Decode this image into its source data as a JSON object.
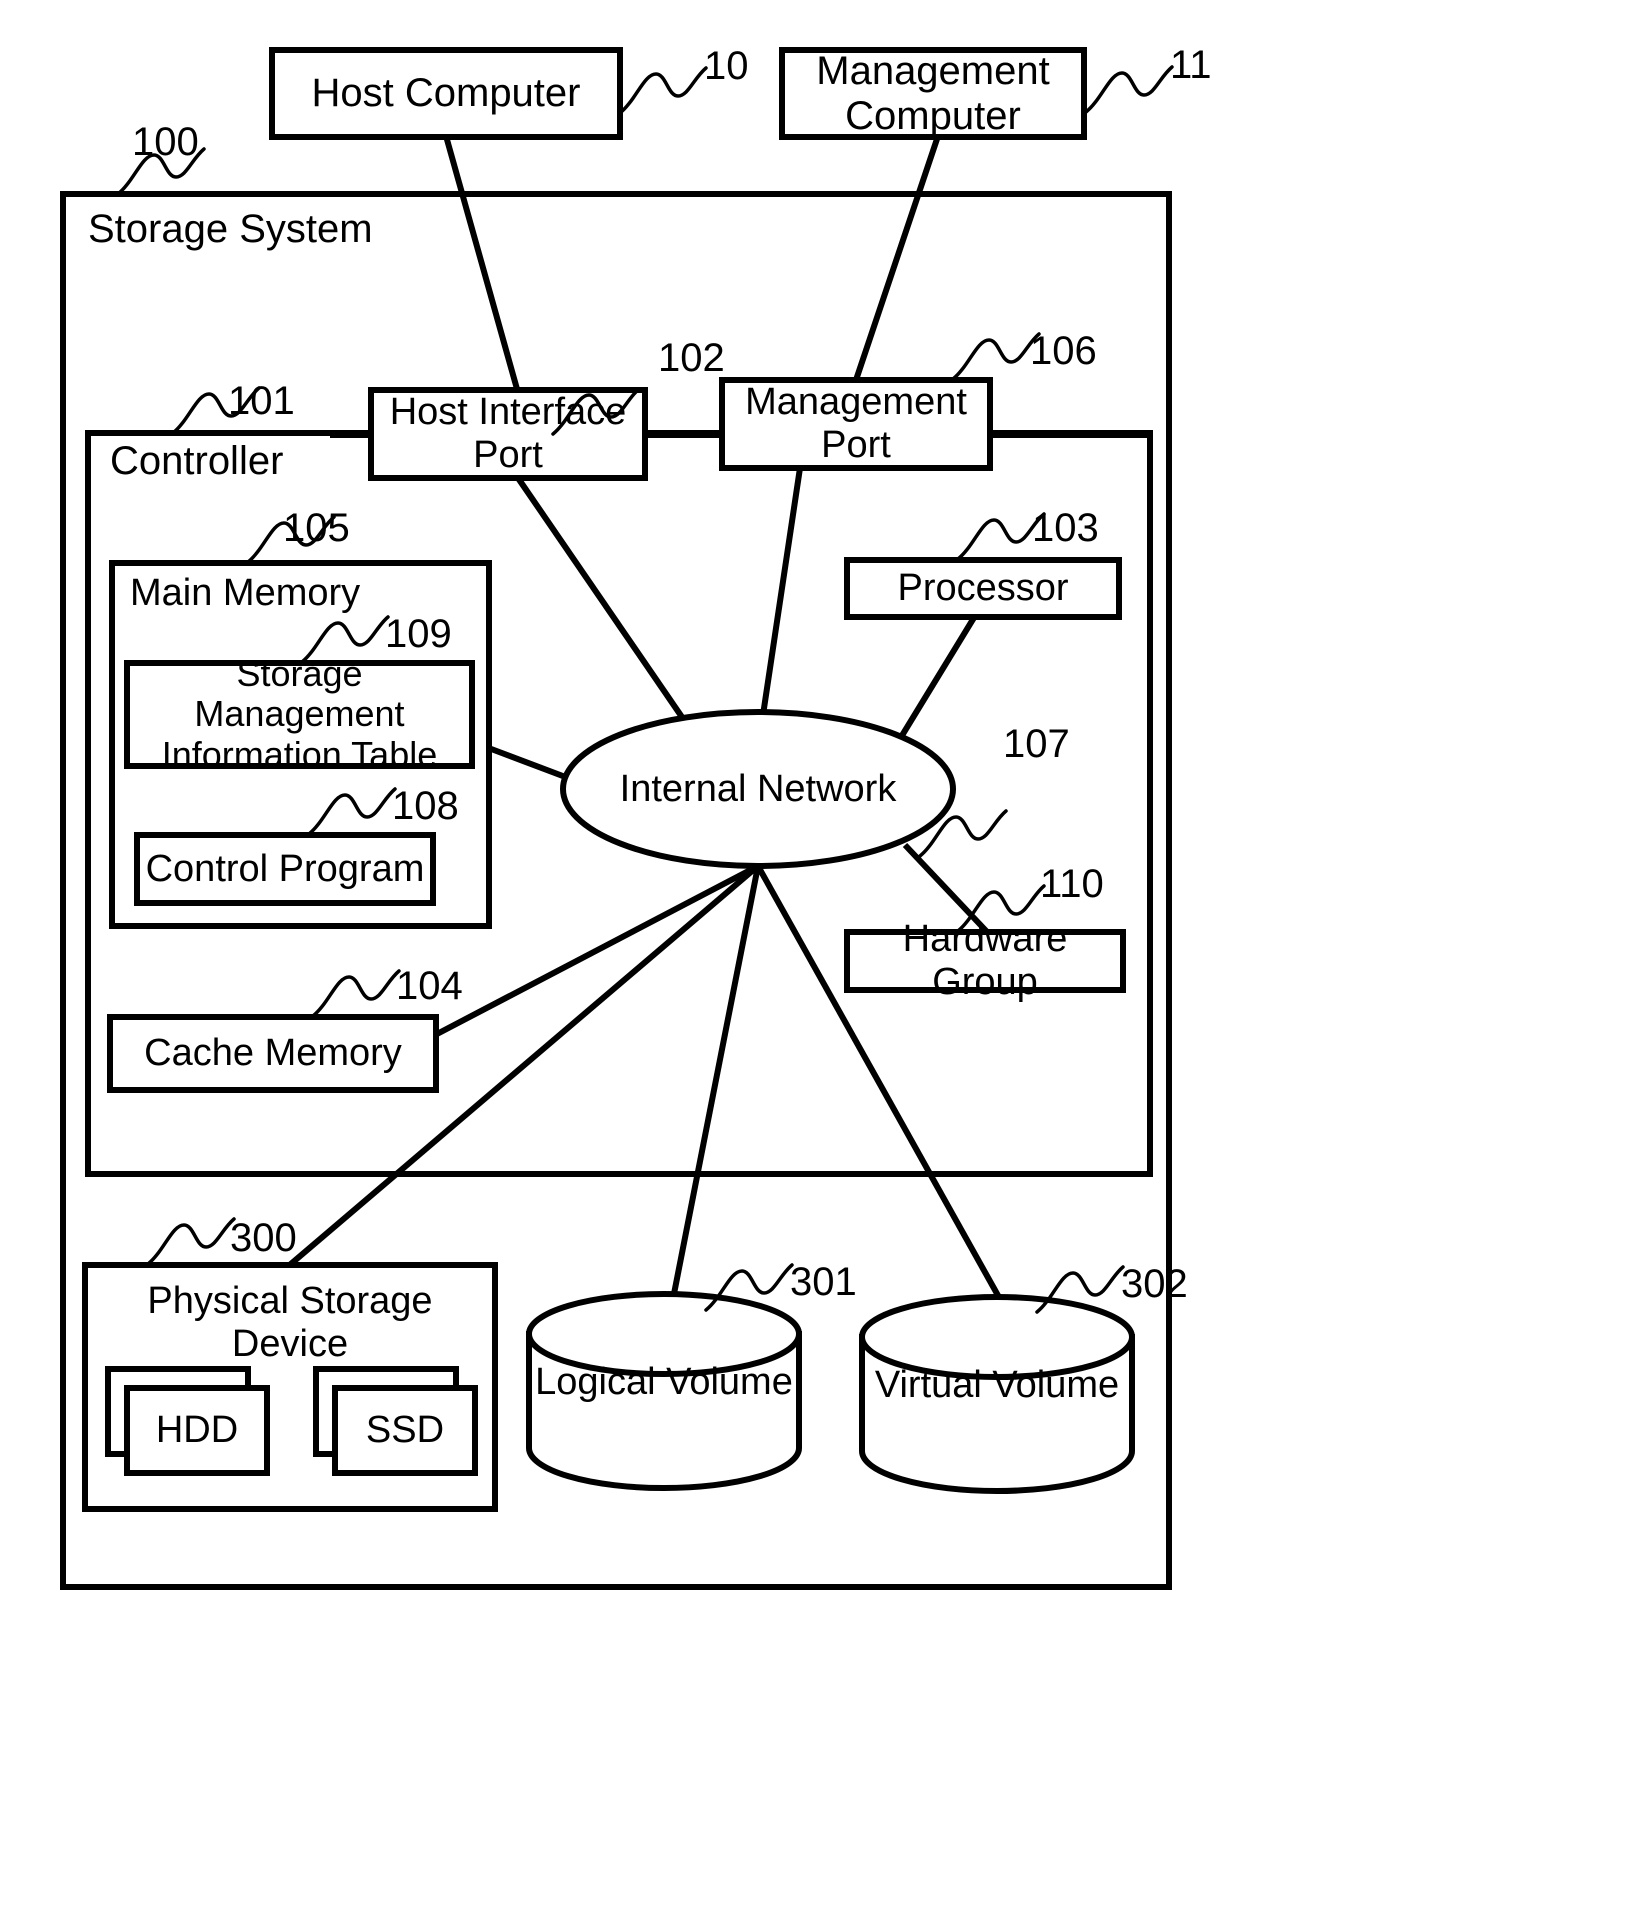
{
  "figure": {
    "kind": "patent-block-diagram",
    "stroke_color": "#000000",
    "fill_color": "#ffffff",
    "background": "#ffffff"
  },
  "external": {
    "host_computer": {
      "label": "Host Computer",
      "ref": "10"
    },
    "management_computer": {
      "label": "Management\nComputer",
      "ref": "11"
    }
  },
  "storage_system": {
    "label": "Storage System",
    "ref": "100"
  },
  "controller": {
    "label": "Controller",
    "ref": "101"
  },
  "ports": {
    "host_interface_port": {
      "label": "Host Interface\nPort",
      "ref": "102"
    },
    "management_port": {
      "label": "Management\nPort",
      "ref": "106"
    }
  },
  "main_memory": {
    "label": "Main Memory",
    "ref": "105",
    "contents": [
      {
        "label": "Storage Management\nInformation Table",
        "ref": "109"
      },
      {
        "label": "Control Program",
        "ref": "108"
      }
    ]
  },
  "cache_memory": {
    "label": "Cache Memory",
    "ref": "104"
  },
  "processor": {
    "label": "Processor",
    "ref": "103"
  },
  "internal_network": {
    "label": "Internal Network",
    "ref": "107"
  },
  "hardware_group": {
    "label": "Hardware Group",
    "ref": "110"
  },
  "physical_storage_device": {
    "label": "Physical Storage\nDevice",
    "ref": "300",
    "drives": [
      {
        "label": "HDD"
      },
      {
        "label": "SSD"
      }
    ]
  },
  "volumes": [
    {
      "label": "Logical Volume",
      "ref": "301"
    },
    {
      "label": "Virtual Volume",
      "ref": "302"
    }
  ]
}
